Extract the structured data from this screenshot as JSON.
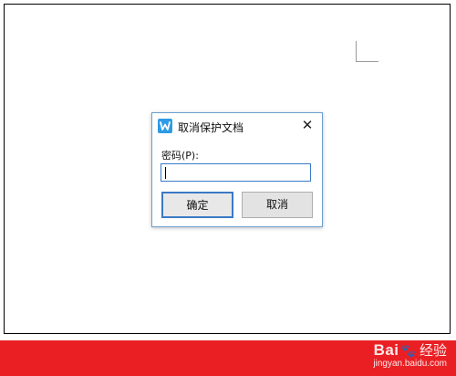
{
  "dialog": {
    "title": "取消保护文档",
    "app_icon": "wps-writer-icon",
    "close_glyph": "✕",
    "password_label": "密码(P):",
    "password_value": "",
    "ok_label": "确定",
    "cancel_label": "取消"
  },
  "watermark": {
    "logo_left": "Bai",
    "logo_paw": "🐾",
    "logo_right": "经验",
    "url": "jingyan.baidu.com"
  },
  "colors": {
    "accent": "#3b79c6",
    "brand_red": "#ea1f24",
    "app_icon": "#2e9be6"
  }
}
